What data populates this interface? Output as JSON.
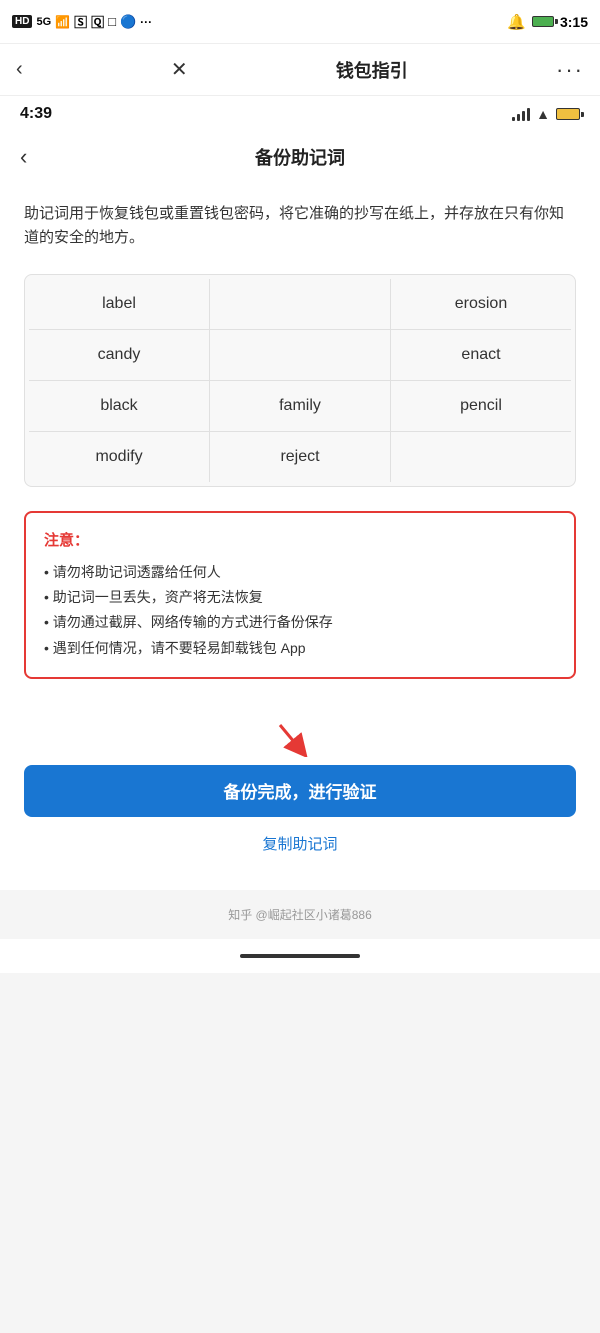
{
  "outer": {
    "status": {
      "left_icons": [
        "HD",
        "5G",
        "📶",
        "🅂",
        "🅀",
        "□",
        "🔵",
        "..."
      ],
      "time": "3:15",
      "bell_icon": "🔔",
      "battery_label": ""
    },
    "nav": {
      "back_label": "‹",
      "close_label": "✕",
      "title": "钱包指引",
      "more_label": "···"
    }
  },
  "inner": {
    "status": {
      "time": "4:39"
    },
    "nav": {
      "back_label": "‹",
      "title": "备份助记词"
    },
    "description": "助记词用于恢复钱包或重置钱包密码，将它准确的抄写在纸上，并存放在只有你知道的安全的地方。",
    "mnemonic": {
      "rows": [
        [
          "label",
          "",
          "erosion"
        ],
        [
          "candy",
          "",
          "enact"
        ],
        [
          "black",
          "family",
          "pencil"
        ],
        [
          "modify",
          "reject",
          ""
        ]
      ]
    },
    "warning": {
      "title": "注意：",
      "items": [
        "• 请勿将助记词透露给任何人",
        "• 助记词一旦丢失，资产将无法恢复",
        "• 请勿通过截屏、网络传输的方式进行备份保存",
        "• 遇到任何情况，请不要轻易卸载钱包 App"
      ]
    },
    "primary_button": "备份完成，进行验证",
    "copy_link": "复制助记词"
  },
  "footer": {
    "text": "知乎 @崛起社区小诸葛886"
  }
}
